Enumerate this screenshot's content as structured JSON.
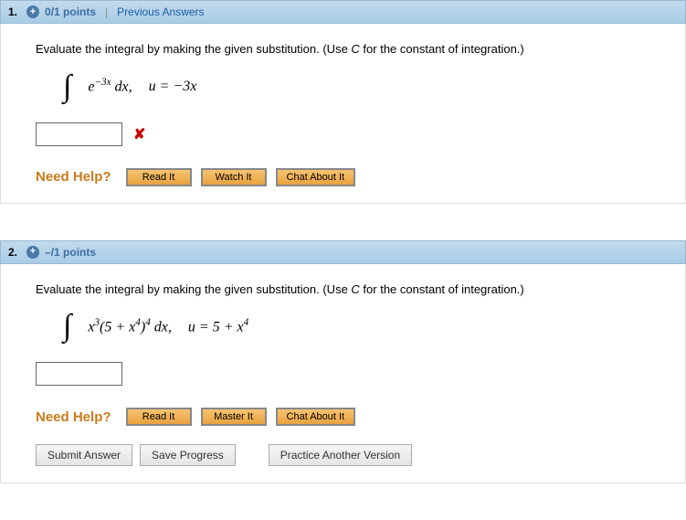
{
  "questions": [
    {
      "num": "1.",
      "points": "0/1 points",
      "prev": "Previous Answers",
      "prompt_a": "Evaluate the integral by making the given substitution. (Use ",
      "prompt_c": "C",
      "prompt_b": " for the constant of integration.)",
      "integrand_html": "e<sup>−3x</sup> <span style='font-style:italic'>dx</span>,",
      "sub_html": "u = −3x",
      "incorrect": true,
      "help_buttons": [
        "Read It",
        "Watch It",
        "Chat About It"
      ]
    },
    {
      "num": "2.",
      "points": "–/1 points",
      "prev": "",
      "prompt_a": "Evaluate the integral by making the given substitution. (Use ",
      "prompt_c": "C",
      "prompt_b": " for the constant of integration.)",
      "integrand_html": "x<sup>3</sup>(5 + x<sup>4</sup>)<sup>4</sup> <span style='font-style:italic'>dx</span>,",
      "sub_html": "u = 5 + x<sup>4</sup>",
      "incorrect": false,
      "help_buttons": [
        "Read It",
        "Master It",
        "Chat About It"
      ]
    }
  ],
  "need_help_label": "Need Help?",
  "bottom": {
    "submit": "Submit Answer",
    "save": "Save Progress",
    "practice": "Practice Another Version"
  }
}
